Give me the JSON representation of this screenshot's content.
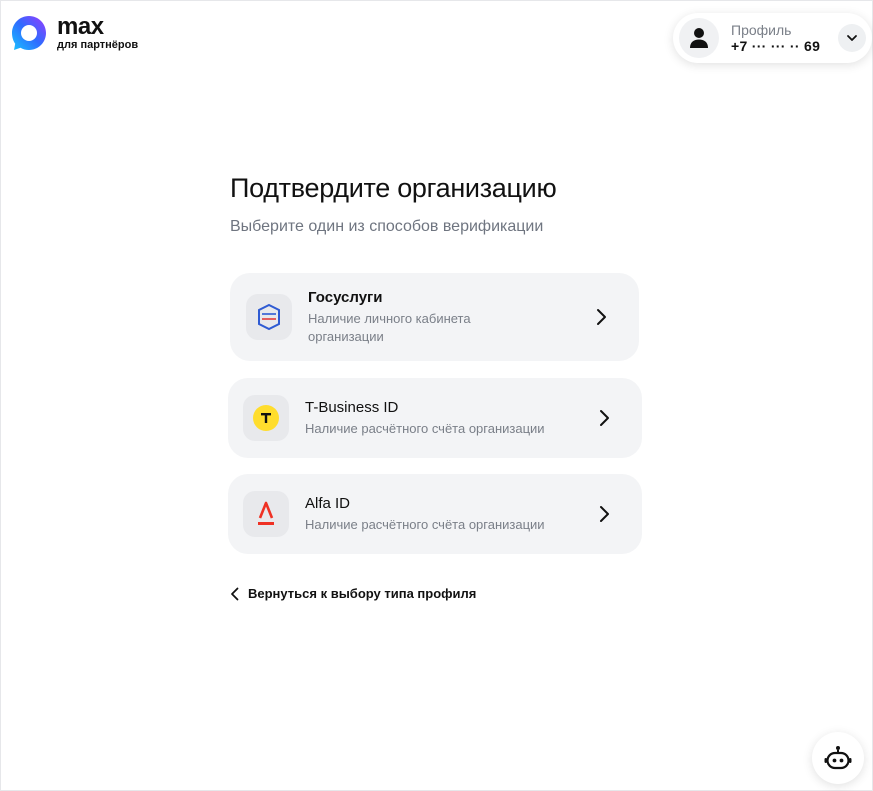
{
  "brand": {
    "name": "max",
    "subtitle": "для партнёров",
    "gradient": [
      "#7b2ff7",
      "#2f6bff",
      "#19c3ff"
    ]
  },
  "profile": {
    "label": "Профиль",
    "phone": "+7 ··· ··· ·· 69",
    "avatar_icon": "user-icon",
    "menu_icon": "chevron-down-icon"
  },
  "main": {
    "title": "Подтвердите организацию",
    "subtitle": "Выберите один из способов верификации"
  },
  "options": [
    {
      "title": "Госуслуги",
      "description": "Наличие личного кабинета организации",
      "icon": "gosuslugi-logo-icon"
    },
    {
      "title": "T-Business ID",
      "description": "Наличие расчётного счёта организации",
      "icon": "t-bank-logo-icon",
      "color": "#ffdd2d"
    },
    {
      "title": "Alfa ID",
      "description": "Наличие расчётного счёта организации",
      "icon": "alfa-bank-logo-icon",
      "color": "#ef3124"
    }
  ],
  "back_link": {
    "label": "Вернуться к выбору типа профиля",
    "icon": "chevron-left-icon"
  },
  "assistant": {
    "icon": "bot-icon"
  }
}
